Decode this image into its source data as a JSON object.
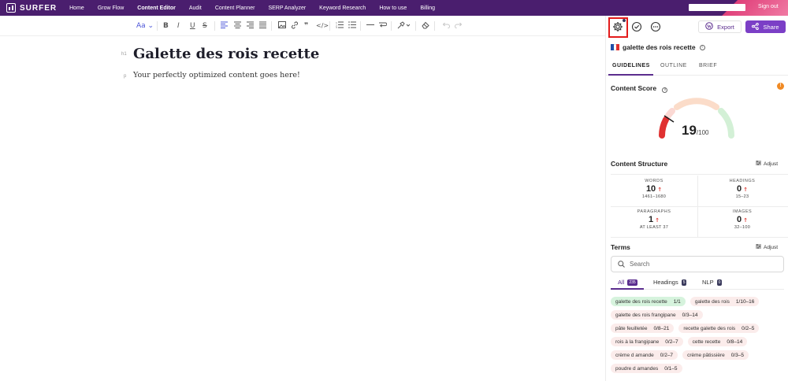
{
  "app": {
    "logo": "SURFER",
    "nav": [
      "Home",
      "Grow Flow",
      "Content Editor",
      "Audit",
      "Content Planner",
      "SERP Analyzer",
      "Keyword Research",
      "How to use",
      "Billing"
    ],
    "active_nav": "Content Editor",
    "sign_out": "Sign out"
  },
  "editor": {
    "toolbar": {
      "font_label": "Aa",
      "items": [
        "bold",
        "italic",
        "underline",
        "strikethrough",
        "align-left",
        "align-center",
        "align-right",
        "justify",
        "image",
        "link",
        "quote",
        "code",
        "ordered-list",
        "bullet-list",
        "horizontal-rule",
        "line-break",
        "format-brush",
        "eraser",
        "undo",
        "redo"
      ]
    },
    "h1_tag": "h1",
    "p_tag": "p",
    "title": "Galette des rois recette",
    "body": "Your perfectly optimized content goes here!"
  },
  "panel": {
    "export_label": "Export",
    "share_label": "Share",
    "keyword": "galette des rois recette",
    "flag_colors": [
      "#1f4fa8",
      "#ffffff",
      "#e0312f"
    ],
    "tabs": [
      "GUIDELINES",
      "OUTLINE",
      "BRIEF"
    ],
    "active_tab": "GUIDELINES",
    "content_score": {
      "title": "Content Score",
      "value": "19",
      "max": "/100",
      "warning_icon": "!"
    },
    "structure": {
      "title": "Content Structure",
      "adjust_label": "Adjust",
      "cells": [
        {
          "label": "WORDS",
          "value": "10",
          "range": "1461–1680"
        },
        {
          "label": "HEADINGS",
          "value": "0",
          "range": "15–23"
        },
        {
          "label": "PARAGRAPHS",
          "value": "1",
          "range": "AT LEAST 37"
        },
        {
          "label": "IMAGES",
          "value": "0",
          "range": "32–100"
        }
      ]
    },
    "terms": {
      "title": "Terms",
      "adjust_label": "Adjust",
      "search_placeholder": "Search",
      "subtabs": [
        {
          "label": "All",
          "count": "235"
        },
        {
          "label": "Headings",
          "count": "5"
        },
        {
          "label": "NLP",
          "count": "0"
        }
      ],
      "chips": [
        [
          {
            "term": "galette des rois recette",
            "count": "1/1",
            "met": true
          },
          {
            "term": "galette des rois",
            "count": "1/10–16",
            "met": false
          }
        ],
        [
          {
            "term": "galette des rois frangipane",
            "count": "0/3–14",
            "met": false
          }
        ],
        [
          {
            "term": "pâte feuilletée",
            "count": "0/8–21",
            "met": false
          },
          {
            "term": "recette galette des rois",
            "count": "0/2–5",
            "met": false
          }
        ],
        [
          {
            "term": "rois à la frangipane",
            "count": "0/2–7",
            "met": false
          },
          {
            "term": "cette recette",
            "count": "0/8–14",
            "met": false
          }
        ],
        [
          {
            "term": "crème d amande",
            "count": "0/2–7",
            "met": false
          },
          {
            "term": "crème pâtissière",
            "count": "0/3–5",
            "met": false
          }
        ],
        [
          {
            "term": "poudre d amandes",
            "count": "0/1–5",
            "met": false
          }
        ]
      ]
    }
  }
}
